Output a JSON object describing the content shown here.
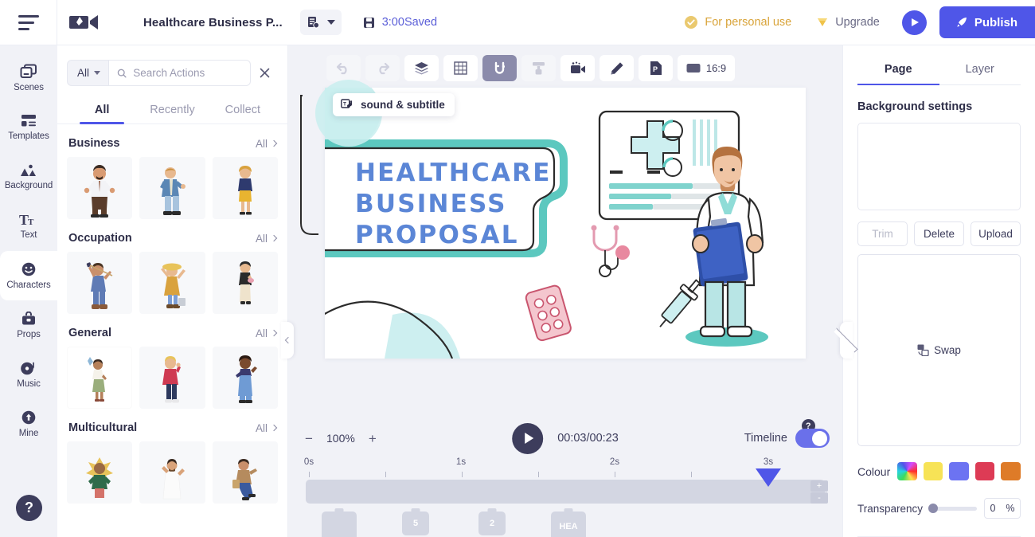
{
  "header": {
    "menu_icon": "hamburger-icon",
    "logo_icon": "video-camera-logo-icon",
    "title": "Healthcare Business P...",
    "chip_icon": "document-clock-icon",
    "save_icon": "floppy-disk-icon",
    "save_text": "3:00Saved",
    "personal_icon": "check-circle-icon",
    "personal_label": "For personal use",
    "upgrade_icon": "diamond-icon",
    "upgrade_label": "Upgrade",
    "preview_icon": "play-icon",
    "publish_icon": "rocket-icon",
    "publish_label": "Publish"
  },
  "rail": {
    "items": [
      {
        "label": "Scenes",
        "icon": "scenes-icon",
        "active": false
      },
      {
        "label": "Templates",
        "icon": "templates-icon",
        "active": false
      },
      {
        "label": "Background",
        "icon": "background-icon",
        "active": false
      },
      {
        "label": "Text",
        "icon": "text-icon",
        "active": false
      },
      {
        "label": "Characters",
        "icon": "characters-icon",
        "active": true
      },
      {
        "label": "Props",
        "icon": "props-icon",
        "active": false
      },
      {
        "label": "Music",
        "icon": "music-icon",
        "active": false
      },
      {
        "label": "Mine",
        "icon": "mine-icon",
        "active": false
      }
    ],
    "help_label": "?"
  },
  "panel": {
    "filter_label": "All",
    "search_placeholder": "Search Actions",
    "search_value": "",
    "close_icon": "close-icon",
    "tabs": [
      {
        "label": "All",
        "active": true
      },
      {
        "label": "Recently",
        "active": false
      },
      {
        "label": "Collect",
        "active": false
      }
    ],
    "all_link": "All",
    "categories": [
      {
        "title": "Business"
      },
      {
        "title": "Occupation"
      },
      {
        "title": "General"
      },
      {
        "title": "Multicultural"
      }
    ]
  },
  "toolbar": {
    "buttons": [
      {
        "name": "undo-icon",
        "label": ""
      },
      {
        "name": "redo-icon",
        "label": ""
      },
      {
        "name": "layers-icon",
        "label": ""
      },
      {
        "name": "grid-icon",
        "label": ""
      },
      {
        "name": "magnet-icon",
        "label": ""
      },
      {
        "name": "paint-roller-icon",
        "label": ""
      },
      {
        "name": "video-camera-icon",
        "label": ""
      },
      {
        "name": "pencil-icon",
        "label": ""
      },
      {
        "name": "page-icon",
        "label": ""
      }
    ],
    "ratio_label": "16:9",
    "ratio_icon": "rectangle-icon"
  },
  "canvas": {
    "tooltip_icon": "sound-subtitle-icon",
    "tooltip_label": "sound & subtitle",
    "slide_title_line1": "HEALTHCARE",
    "slide_title_line2": "BUSINESS",
    "slide_title_line3": "PROPOSAL",
    "title_color": "#5b86d6",
    "accent_teal": "#5cc8bf",
    "accent_light": "#c9eeee"
  },
  "bottom": {
    "zoom_out_icon": "minus-icon",
    "zoom_value": "100%",
    "zoom_in_icon": "plus-icon",
    "play_icon": "play-icon",
    "timecode": "00:03/00:23",
    "timeline_label": "Timeline",
    "timeline_help": "?",
    "timeline_on": true
  },
  "timeline": {
    "ruler_labels": [
      "0s",
      "1s",
      "2s",
      "3s"
    ],
    "zoom_in": "+",
    "zoom_out": "-",
    "frames": [
      {
        "label": "",
        "lines": false
      },
      {
        "label": "5",
        "lines": true
      },
      {
        "label": "2",
        "lines": true
      },
      {
        "label": "HEA",
        "lines": false
      }
    ]
  },
  "right": {
    "tabs": [
      {
        "label": "Page",
        "active": true
      },
      {
        "label": "Layer",
        "active": false
      }
    ],
    "section_title": "Background settings",
    "trim_label": "Trim",
    "delete_label": "Delete",
    "upload_label": "Upload",
    "swap_icon": "swap-icon",
    "swap_label": "Swap",
    "colour_label": "Colour",
    "swatches": [
      "rainbow",
      "#F7E356",
      "#6C73F2",
      "#DD3B55",
      "#DE7B28"
    ],
    "transparency_label": "Transparency",
    "transparency_value": "0",
    "transparency_unit": "%"
  }
}
